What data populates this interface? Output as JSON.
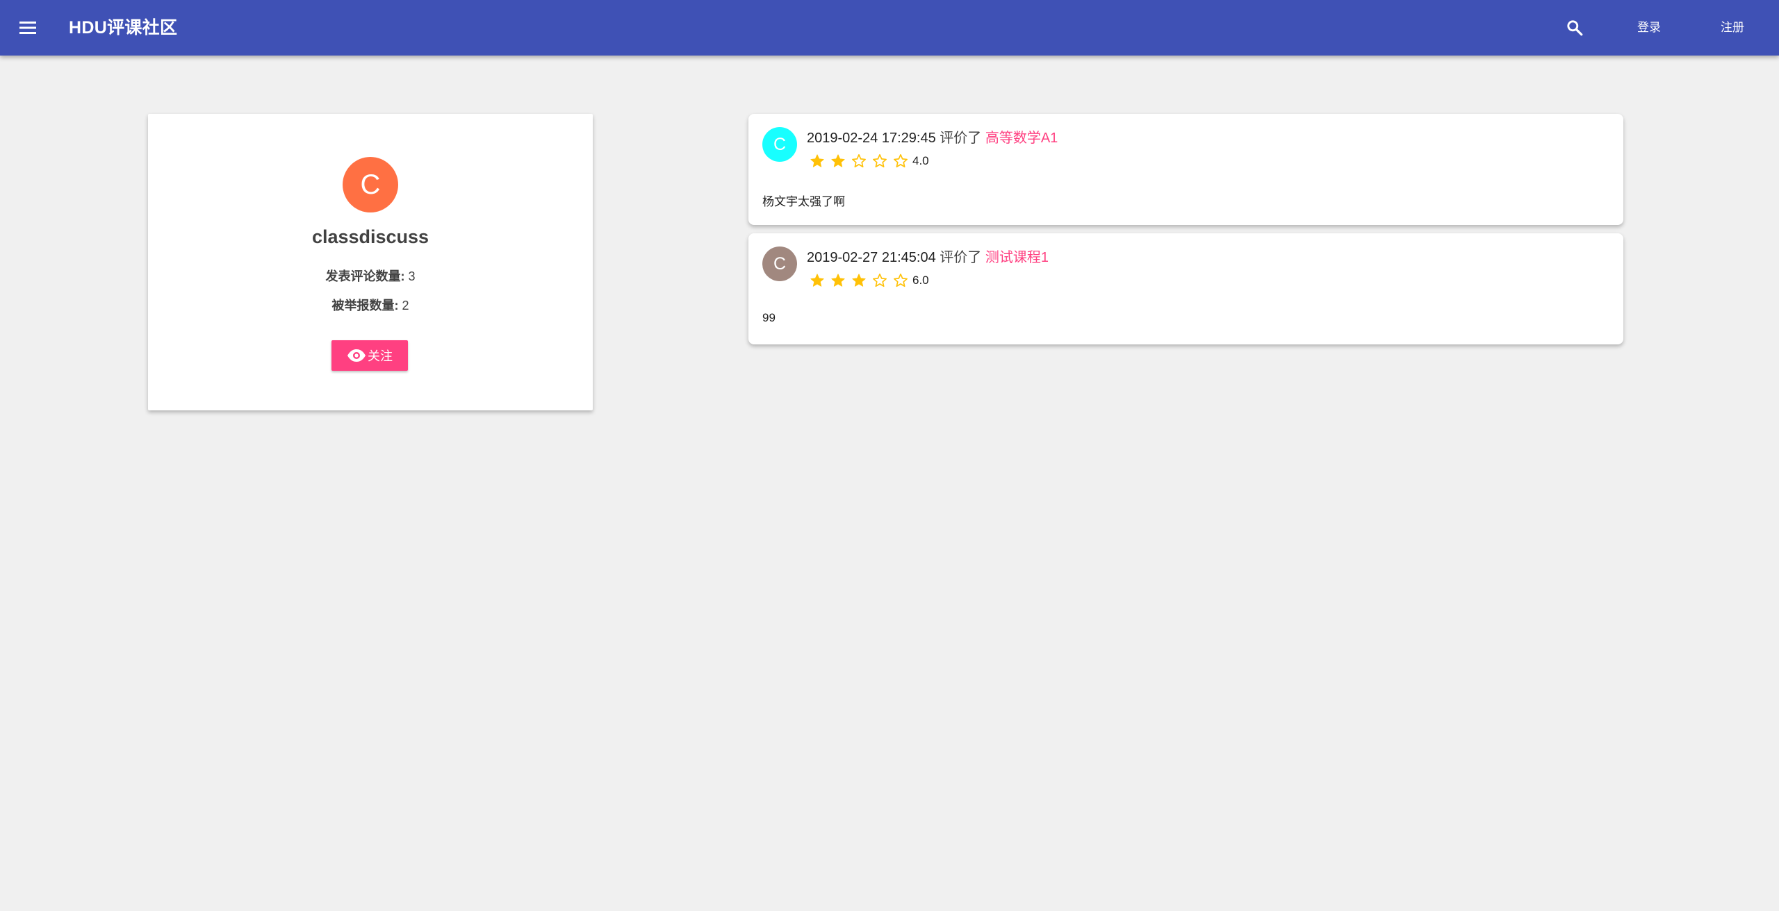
{
  "appbar": {
    "brand": "HDU评课社区",
    "login_label": "登录",
    "register_label": "注册",
    "background": "#3f51b5"
  },
  "profile": {
    "avatar_letter": "C",
    "avatar_color": "#ff7043",
    "name": "classdiscuss",
    "comments_label": "发表评论数量:",
    "comments_count": "3",
    "reports_label": "被举报数量:",
    "reports_count": "2",
    "follow_label": "关注",
    "follow_color": "#ff4081"
  },
  "comments": [
    {
      "avatar_letter": "C",
      "avatar_color": "#18ffff",
      "timestamp": "2019-02-24 17:29:45",
      "verb": "评价了",
      "course": "高等数学A1",
      "rating": 2,
      "rating_max": 5,
      "score": "4.0",
      "text": "杨文宇太强了啊"
    },
    {
      "avatar_letter": "C",
      "avatar_color": "#a1887f",
      "timestamp": "2019-02-27 21:45:04",
      "verb": "评价了",
      "course": "测试课程1",
      "rating": 3,
      "rating_max": 5,
      "score": "6.0",
      "text": "99"
    }
  ]
}
